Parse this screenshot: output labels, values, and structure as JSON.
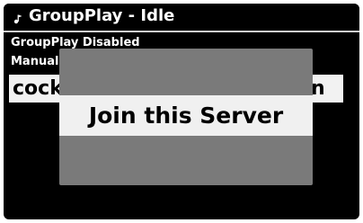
{
  "header": {
    "title": "GroupPlay - Idle",
    "icon": "music-note-icon"
  },
  "list": {
    "status": "GroupPlay Disabled",
    "manual": "Manual",
    "selected_item": "cock",
    "selected_item_suffix": "n"
  },
  "dialog": {
    "option_label": "Join this Server"
  },
  "colors": {
    "screen_bg": "#000000",
    "dialog_bg": "#7a7a7a",
    "highlight_bg": "#f0f0f0",
    "text_light": "#ffffff",
    "text_dark": "#000000"
  }
}
